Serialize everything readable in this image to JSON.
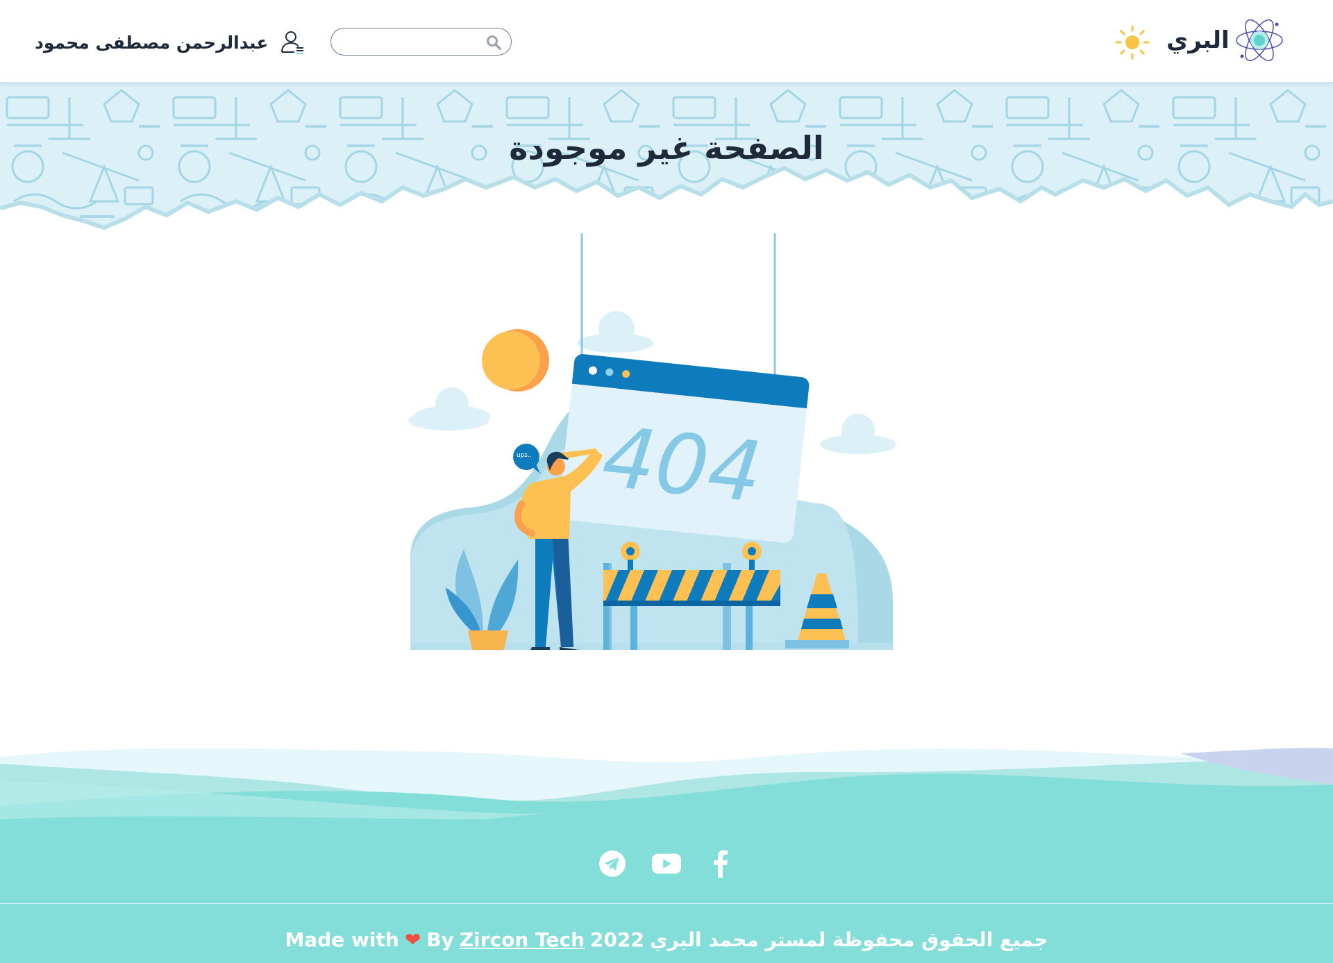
{
  "header": {
    "brand_name": "البري",
    "user_name": "عبدالرحمن مصطفى محمود",
    "search_placeholder": ""
  },
  "main": {
    "page_title": "الصفحة غير موجودة",
    "illustration": {
      "code": "404",
      "speech": "ups.."
    }
  },
  "footer": {
    "socials": [
      "telegram-icon",
      "youtube-icon",
      "facebook-icon"
    ],
    "made_with": "Made with",
    "by": "By",
    "company": "Zircon Tech",
    "year": "2022",
    "rights": "جميع الحقوق محفوظة لمستر محمد البري"
  },
  "colors": {
    "accent": "#7fd9d6",
    "footer_bg": "#83deda",
    "banner_bg": "#d7eef5",
    "dark_text": "#1e2a3a",
    "heart": "#f24e3c",
    "sun": "#f9c443",
    "hero_blue": "#0e7bbd"
  }
}
